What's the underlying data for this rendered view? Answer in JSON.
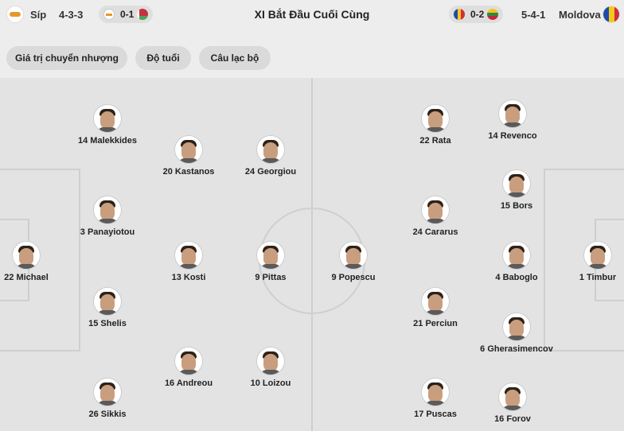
{
  "header": {
    "home_team": "Síp",
    "home_formation": "4-3-3",
    "home_pill_score": "0-1",
    "title": "XI Bắt Đầu Cuối Cùng",
    "away_pill_score": "0-2",
    "away_formation": "5-4-1",
    "away_team": "Moldova"
  },
  "tabs": [
    "Giá trị chuyển nhượng",
    "Độ tuổi",
    "Câu lạc bộ"
  ],
  "home_players": [
    {
      "label": "14 Malekkides"
    },
    {
      "label": "20 Kastanos"
    },
    {
      "label": "24 Georgiou"
    },
    {
      "label": "3 Panayiotou"
    },
    {
      "label": "22 Michael"
    },
    {
      "label": "13 Kosti"
    },
    {
      "label": "9 Pittas"
    },
    {
      "label": "15 Shelis"
    },
    {
      "label": "16 Andreou"
    },
    {
      "label": "10 Loizou"
    },
    {
      "label": "26 Sikkis"
    }
  ],
  "away_players": [
    {
      "label": "22 Rata"
    },
    {
      "label": "14 Revenco"
    },
    {
      "label": "15 Bors"
    },
    {
      "label": "24 Cararus"
    },
    {
      "label": "9 Popescu"
    },
    {
      "label": "4 Baboglo"
    },
    {
      "label": "1 Timbur"
    },
    {
      "label": "21 Perciun"
    },
    {
      "label": "6 Gherasimencov"
    },
    {
      "label": "17 Puscas"
    },
    {
      "label": "16 Forov"
    }
  ],
  "colors": {
    "background": "#ededed",
    "pitch": "#e3e3e3",
    "pitch_lines": "#cfcfcf",
    "pill": "#dedede"
  }
}
